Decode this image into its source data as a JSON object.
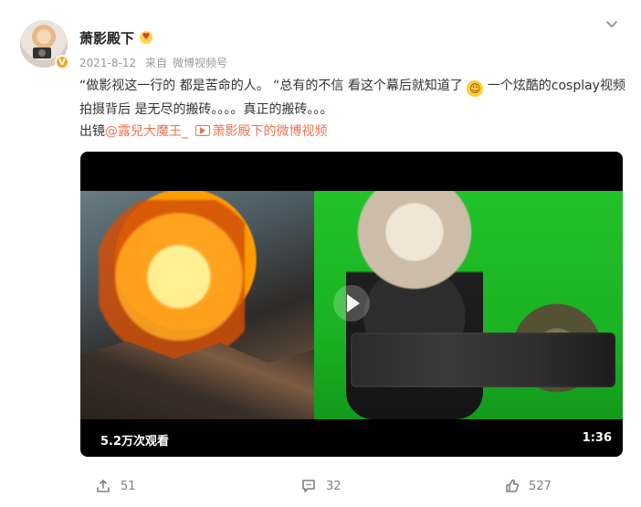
{
  "post": {
    "username": "萧影殿下",
    "timestamp": "2021-8-12",
    "source_prefix": "来自",
    "source": "微博视频号",
    "content_part1": "“做影视这一行的 都是苦命的人。 “总有的不信  看这个幕后就知道了",
    "content_part2": " 一个炫酷的cosplay视频拍摄背后 是无尽的搬砖。。。。真正的搬砖。。。",
    "mentions_prefix": "出镜",
    "mention_user": "@露兒大魔王_",
    "video_link_text": "萧影殿下的微博视频",
    "video": {
      "views": "5.2万次观看",
      "duration": "1:36"
    },
    "actions": {
      "repost_count": "51",
      "comment_count": "32",
      "like_count": "527"
    }
  },
  "icons": {
    "verified": "verified-badge-icon",
    "heart": "heart-face-icon",
    "chevron": "chevron-down-icon",
    "laugh": "laugh-emoji-icon",
    "video": "video-link-icon",
    "share": "share-icon",
    "comment": "comment-icon",
    "like": "like-icon"
  },
  "colors": {
    "accent": "#eb7350",
    "muted": "#999999",
    "text": "#333333"
  }
}
